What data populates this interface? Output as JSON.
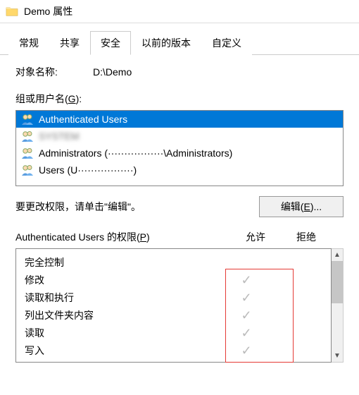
{
  "window": {
    "title": "Demo 属性"
  },
  "tabs": {
    "items": [
      "常规",
      "共享",
      "安全",
      "以前的版本",
      "自定义"
    ],
    "active_index": 2
  },
  "object": {
    "label": "对象名称:",
    "path": "D:\\Demo"
  },
  "groups": {
    "label_pre": "组或用户名(",
    "label_key": "G",
    "label_post": "):",
    "items": [
      {
        "name": "Authenticated Users",
        "selected": true
      },
      {
        "name": "SYSTEM",
        "selected": false,
        "obscured": true
      },
      {
        "name": "Administrators (·················\\Administrators)",
        "selected": false,
        "obscured_partial": true
      },
      {
        "name": "Users (U·················)",
        "selected": false,
        "obscured_partial": true
      }
    ]
  },
  "edit_hint": "要更改权限，请单击\"编辑\"。",
  "edit_btn_pre": "编辑(",
  "edit_btn_key": "E",
  "edit_btn_post": ")...",
  "perm_header": {
    "label_pre": "Authenticated Users 的权限(",
    "label_key": "P",
    "label_post": ")",
    "allow": "允许",
    "deny": "拒绝"
  },
  "permissions": [
    {
      "name": "完全控制",
      "allow": false,
      "deny": false
    },
    {
      "name": "修改",
      "allow": true,
      "deny": false
    },
    {
      "name": "读取和执行",
      "allow": true,
      "deny": false
    },
    {
      "name": "列出文件夹内容",
      "allow": true,
      "deny": false
    },
    {
      "name": "读取",
      "allow": true,
      "deny": false
    },
    {
      "name": "写入",
      "allow": true,
      "deny": false
    }
  ],
  "icons": {
    "check": "✓"
  }
}
